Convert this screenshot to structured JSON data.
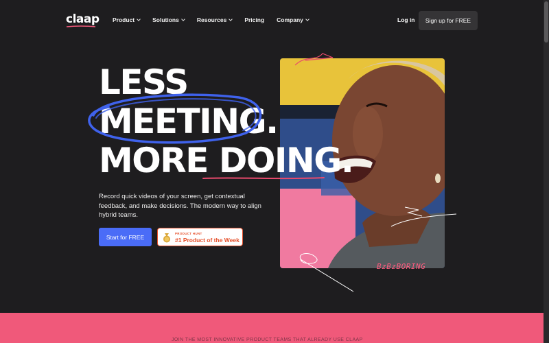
{
  "nav": {
    "logo": "claap",
    "menu": [
      {
        "label": "Product"
      },
      {
        "label": "Solutions"
      },
      {
        "label": "Resources"
      },
      {
        "label": "Pricing"
      },
      {
        "label": "Company"
      }
    ],
    "login": "Log in",
    "signup": "Sign up for FREE"
  },
  "hero": {
    "line1": "LESS",
    "line2": "MEETING.",
    "line3": "MORE DOING.",
    "description": "Record quick videos of your screen, get contextual feedback, and make decisions. The modern way to align hybrid teams.",
    "cta": "Start for FREE",
    "product_hunt": {
      "small": "PRODUCT HUNT",
      "big": "#1 Product of the Week"
    },
    "scribble_text": "BzBzBORING"
  },
  "band": {
    "text": "JOIN THE MOST INNOVATIVE PRODUCT TEAMS THAT ALREADY USE CLAAP"
  },
  "colors": {
    "background": "#1e1d1f",
    "accent_blue": "#4a6cf7",
    "accent_pink": "#f0597a",
    "product_hunt": "#e6502b"
  }
}
